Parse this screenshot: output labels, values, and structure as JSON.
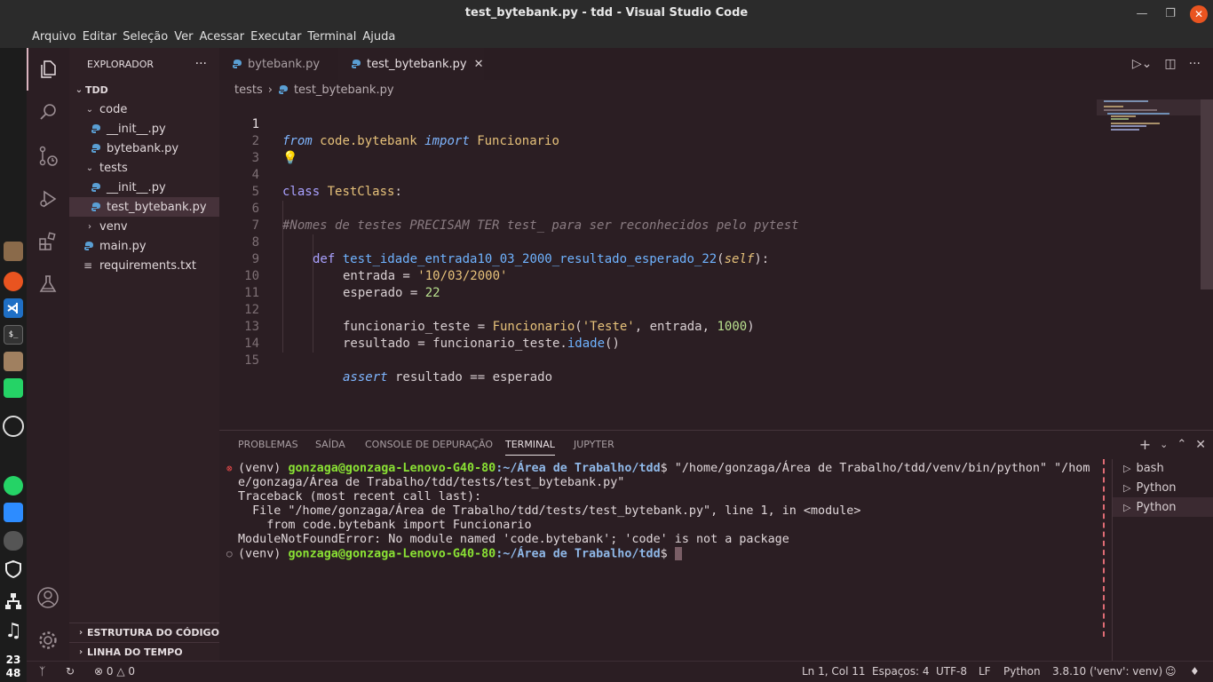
{
  "window": {
    "title": "test_bytebank.py - tdd - Visual Studio Code"
  },
  "menu": [
    "Arquivo",
    "Editar",
    "Seleção",
    "Ver",
    "Acessar",
    "Executar",
    "Terminal",
    "Ajuda"
  ],
  "dock": {
    "time_hour": "23",
    "time_min": "48"
  },
  "sidebar": {
    "title": "EXPLORADOR",
    "more": "···",
    "root": "TDD",
    "items": [
      {
        "label": "code"
      },
      {
        "label": "__init__.py"
      },
      {
        "label": "bytebank.py"
      },
      {
        "label": "tests"
      },
      {
        "label": "__init__.py"
      },
      {
        "label": "test_bytebank.py"
      },
      {
        "label": "venv"
      },
      {
        "label": "main.py"
      },
      {
        "label": "requirements.txt"
      }
    ],
    "outline": "ESTRUTURA DO CÓDIGO",
    "timeline": "LINHA DO TEMPO"
  },
  "tabs": [
    {
      "label": "bytebank.py"
    },
    {
      "label": "test_bytebank.py"
    }
  ],
  "breadcrumb": {
    "folder": "tests",
    "file": "test_bytebank.py"
  },
  "editor": {
    "line_numbers": [
      "1",
      "2",
      "3",
      "4",
      "5",
      "6",
      "7",
      "8",
      "9",
      "10",
      "11",
      "12",
      "13",
      "14",
      "15"
    ],
    "code": {
      "l1_from": "from",
      "l1_mod": "code.bytebank",
      "l1_import": "import",
      "l1_name": "Funcionario",
      "l4_class": "class",
      "l4_name": "TestClass",
      "l4_colon": ":",
      "l6_comment": "#Nomes de testes PRECISAM TER test_ para ser reconhecidos pelo pytest",
      "l8_def": "def",
      "l8_fn": "test_idade_entrada10_03_2000_resultado_esperado_22",
      "l8_open": "(",
      "l8_self": "self",
      "l8_close": "):",
      "l9_var": "entrada = ",
      "l9_str": "'10/03/2000'",
      "l10_var": "esperado = ",
      "l10_num": "22",
      "l12_var": "funcionario_teste = ",
      "l12_cls": "Funcionario",
      "l12_open": "(",
      "l12_str": "'Teste'",
      "l12_mid": ", entrada, ",
      "l12_num": "1000",
      "l12_close": ")",
      "l13_var": "resultado = funcionario_teste.",
      "l13_fn": "idade",
      "l13_close": "()",
      "l15_assert": "assert",
      "l15_rest": " resultado == esperado"
    }
  },
  "panel": {
    "tabs": [
      "PROBLEMAS",
      "SAÍDA",
      "CONSOLE DE DEPURAÇÃO",
      "TERMINAL",
      "JUPYTER"
    ],
    "terminal": {
      "prompt_env": "(venv) ",
      "user_host": "gonzaga@gonzaga-Lenovo-G40-80",
      "path": ":~/Área de Trabalho/tdd",
      "line1_cmd": "$ \"/home/gonzaga/Área de Trabalho/tdd/venv/bin/python\" \"/hom",
      "line2": "e/gonzaga/Área de Trabalho/tdd/tests/test_bytebank.py\"",
      "line3": "Traceback (most recent call last):",
      "line4": "  File \"/home/gonzaga/Área de Trabalho/tdd/tests/test_bytebank.py\", line 1, in <module>",
      "line5": "    from code.bytebank import Funcionario",
      "line6": "ModuleNotFoundError: No module named 'code.bytebank'; 'code' is not a package",
      "prompt_end": "$ "
    },
    "terminal_list": [
      "bash",
      "Python",
      "Python"
    ]
  },
  "statusbar": {
    "problems_errors": "0",
    "problems_warnings": "0",
    "position": "Ln 1, Col 11",
    "spaces": "Espaços: 4",
    "encoding": "UTF-8",
    "eol": "LF",
    "language": "Python",
    "interpreter": "3.8.10 ('venv': venv)"
  },
  "colors": {
    "editor_bg": "#2b1e23",
    "sidebar_bg": "#2e2025",
    "keyword": "#7fb6ff",
    "function": "#6fb3ff",
    "string": "#e6c17a",
    "number": "#b9e08e",
    "terminal_user": "#8ae234",
    "terminal_path": "#8fb8e8",
    "ubuntu_orange": "#e95420"
  }
}
